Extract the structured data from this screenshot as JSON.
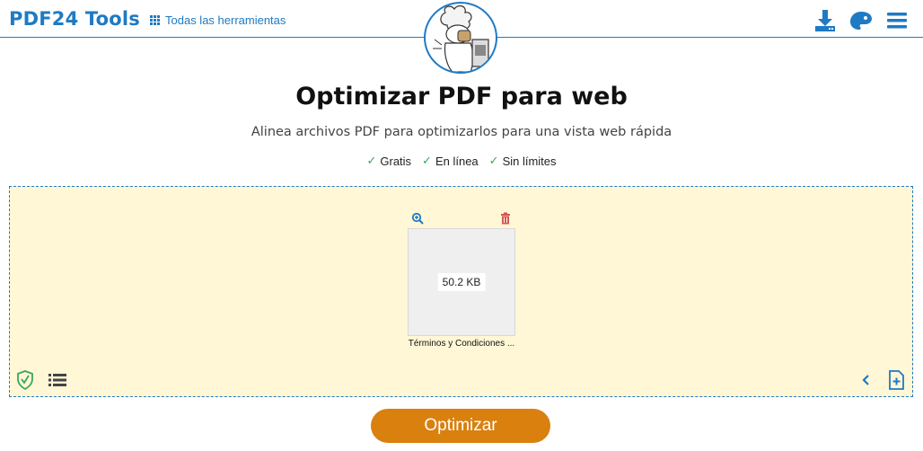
{
  "header": {
    "brand": "PDF24 Tools",
    "all_tools_label": "Todas las herramientas",
    "icons": [
      "download-icon",
      "palette-icon",
      "menu-icon"
    ]
  },
  "main": {
    "title": "Optimizar PDF para web",
    "subtitle": "Alinea archivos PDF para optimizarlos para una vista web rápida",
    "features": [
      "Gratis",
      "En línea",
      "Sin límites"
    ]
  },
  "dropzone": {
    "file": {
      "size": "50.2 KB",
      "name": "Términos y Condiciones ..."
    }
  },
  "action": {
    "optimize_label": "Optimizar"
  },
  "colors": {
    "brand_blue": "#1f7ac4",
    "dropzone_bg": "#fff7d6",
    "button_orange": "#d9800f",
    "check_green": "#3aa65a",
    "delete_red": "#d9534f"
  }
}
